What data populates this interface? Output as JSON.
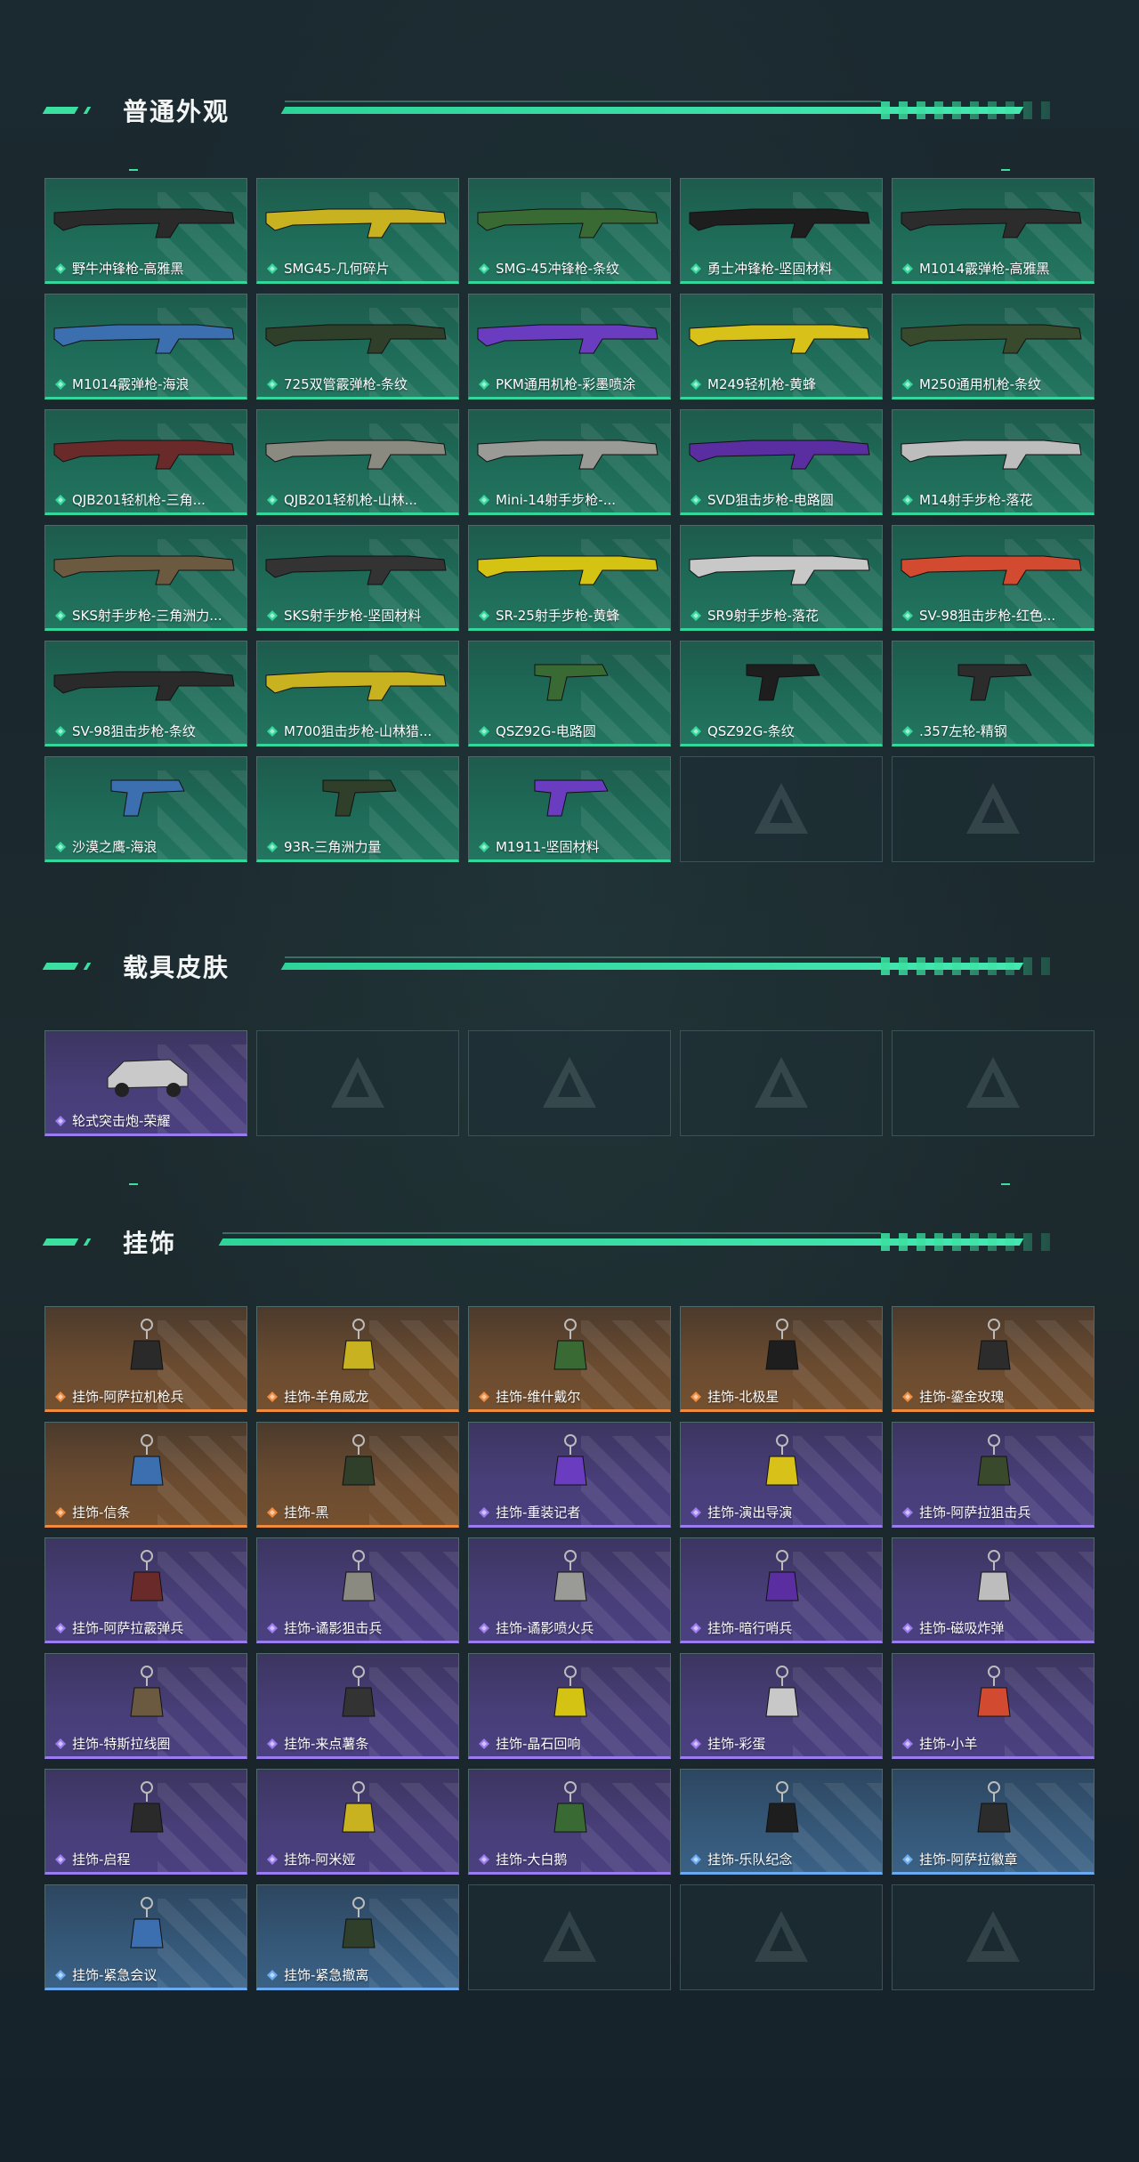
{
  "sections": {
    "normal": {
      "title": "普通外观",
      "items": [
        {
          "label": "野牛冲锋枪-高雅黑",
          "rarity": "green",
          "icon": "smg-icon"
        },
        {
          "label": "SMG45-几何碎片",
          "rarity": "green",
          "icon": "smg-icon"
        },
        {
          "label": "SMG-45冲锋枪-条纹",
          "rarity": "green",
          "icon": "smg-icon"
        },
        {
          "label": "勇士冲锋枪-坚固材料",
          "rarity": "green",
          "icon": "smg-icon"
        },
        {
          "label": "M1014霰弹枪-高雅黑",
          "rarity": "green",
          "icon": "shotgun-icon"
        },
        {
          "label": "M1014霰弹枪-海浪",
          "rarity": "green",
          "icon": "shotgun-icon"
        },
        {
          "label": "725双管霰弹枪-条纹",
          "rarity": "green",
          "icon": "shotgun-icon"
        },
        {
          "label": "PKM通用机枪-彩墨喷涂",
          "rarity": "green",
          "icon": "machine-gun-icon"
        },
        {
          "label": "M249轻机枪-黄蜂",
          "rarity": "green",
          "icon": "machine-gun-icon"
        },
        {
          "label": "M250通用机枪-条纹",
          "rarity": "green",
          "icon": "machine-gun-icon"
        },
        {
          "label": "QJB201轻机枪-三角...",
          "rarity": "green",
          "icon": "machine-gun-icon"
        },
        {
          "label": "QJB201轻机枪-山林...",
          "rarity": "green",
          "icon": "machine-gun-icon"
        },
        {
          "label": "Mini-14射手步枪-...",
          "rarity": "green",
          "icon": "rifle-icon"
        },
        {
          "label": "SVD狙击步枪-电路圆",
          "rarity": "green",
          "icon": "sniper-icon"
        },
        {
          "label": "M14射手步枪-落花",
          "rarity": "green",
          "icon": "rifle-icon"
        },
        {
          "label": "SKS射手步枪-三角洲力...",
          "rarity": "green",
          "icon": "rifle-icon"
        },
        {
          "label": "SKS射手步枪-坚固材料",
          "rarity": "green",
          "icon": "rifle-icon"
        },
        {
          "label": "SR-25射手步枪-黄蜂",
          "rarity": "green",
          "icon": "rifle-icon"
        },
        {
          "label": "SR9射手步枪-落花",
          "rarity": "green",
          "icon": "rifle-icon"
        },
        {
          "label": "SV-98狙击步枪-红色...",
          "rarity": "green",
          "icon": "sniper-icon"
        },
        {
          "label": "SV-98狙击步枪-条纹",
          "rarity": "green",
          "icon": "sniper-icon"
        },
        {
          "label": "M700狙击步枪-山林猎...",
          "rarity": "green",
          "icon": "sniper-icon"
        },
        {
          "label": "QSZ92G-电路圆",
          "rarity": "green",
          "icon": "pistol-icon"
        },
        {
          "label": "QSZ92G-条纹",
          "rarity": "green",
          "icon": "pistol-icon"
        },
        {
          "label": ".357左轮-精钢",
          "rarity": "green",
          "icon": "revolver-icon"
        },
        {
          "label": "沙漠之鹰-海浪",
          "rarity": "green",
          "icon": "pistol-icon"
        },
        {
          "label": "93R-三角洲力量",
          "rarity": "green",
          "icon": "pistol-icon"
        },
        {
          "label": "M1911-坚固材料",
          "rarity": "green",
          "icon": "pistol-icon"
        }
      ],
      "slots": 30
    },
    "vehicle": {
      "title": "载具皮肤",
      "items": [
        {
          "label": "轮式突击炮-荣耀",
          "rarity": "purple",
          "icon": "vehicle-icon"
        }
      ],
      "slots": 5
    },
    "charm": {
      "title": "挂饰",
      "items": [
        {
          "label": "挂饰-阿萨拉机枪兵",
          "rarity": "orange",
          "icon": "charm-icon"
        },
        {
          "label": "挂饰-羊角威龙",
          "rarity": "orange",
          "icon": "charm-icon"
        },
        {
          "label": "挂饰-维什戴尔",
          "rarity": "orange",
          "icon": "charm-icon"
        },
        {
          "label": "挂饰-北极星",
          "rarity": "orange",
          "icon": "charm-icon"
        },
        {
          "label": "挂饰-鎏金玫瑰",
          "rarity": "orange",
          "icon": "charm-icon"
        },
        {
          "label": "挂饰-信条",
          "rarity": "orange",
          "icon": "charm-icon"
        },
        {
          "label": "挂饰-黑",
          "rarity": "orange",
          "icon": "charm-icon"
        },
        {
          "label": "挂饰-重装记者",
          "rarity": "purple",
          "icon": "charm-icon"
        },
        {
          "label": "挂饰-演出导演",
          "rarity": "purple",
          "icon": "charm-icon"
        },
        {
          "label": "挂饰-阿萨拉狙击兵",
          "rarity": "purple",
          "icon": "charm-icon"
        },
        {
          "label": "挂饰-阿萨拉霰弹兵",
          "rarity": "purple",
          "icon": "charm-icon"
        },
        {
          "label": "挂饰-谲影狙击兵",
          "rarity": "purple",
          "icon": "charm-icon"
        },
        {
          "label": "挂饰-谲影喷火兵",
          "rarity": "purple",
          "icon": "charm-icon"
        },
        {
          "label": "挂饰-暗行哨兵",
          "rarity": "purple",
          "icon": "charm-icon"
        },
        {
          "label": "挂饰-磁吸炸弹",
          "rarity": "purple",
          "icon": "charm-icon"
        },
        {
          "label": "挂饰-特斯拉线圈",
          "rarity": "purple",
          "icon": "charm-icon"
        },
        {
          "label": "挂饰-来点薯条",
          "rarity": "purple",
          "icon": "charm-icon"
        },
        {
          "label": "挂饰-晶石回响",
          "rarity": "purple",
          "icon": "charm-icon"
        },
        {
          "label": "挂饰-彩蛋",
          "rarity": "purple",
          "icon": "charm-icon"
        },
        {
          "label": "挂饰-小羊",
          "rarity": "purple",
          "icon": "charm-icon"
        },
        {
          "label": "挂饰-启程",
          "rarity": "purple",
          "icon": "charm-icon"
        },
        {
          "label": "挂饰-阿米娅",
          "rarity": "purple",
          "icon": "charm-icon"
        },
        {
          "label": "挂饰-大白鹅",
          "rarity": "purple",
          "icon": "charm-icon"
        },
        {
          "label": "挂饰-乐队纪念",
          "rarity": "blue",
          "icon": "charm-icon"
        },
        {
          "label": "挂饰-阿萨拉徽章",
          "rarity": "blue",
          "icon": "charm-icon"
        },
        {
          "label": "挂饰-紧急会议",
          "rarity": "blue",
          "icon": "charm-icon"
        },
        {
          "label": "挂饰-紧急撤离",
          "rarity": "blue",
          "icon": "charm-icon"
        }
      ],
      "slots": 30
    }
  },
  "colors": {
    "accent": "#3be0a0",
    "green": "#34d79b",
    "purple": "#9b7bf0",
    "orange": "#f08a3c",
    "blue": "#6aaaf0"
  }
}
